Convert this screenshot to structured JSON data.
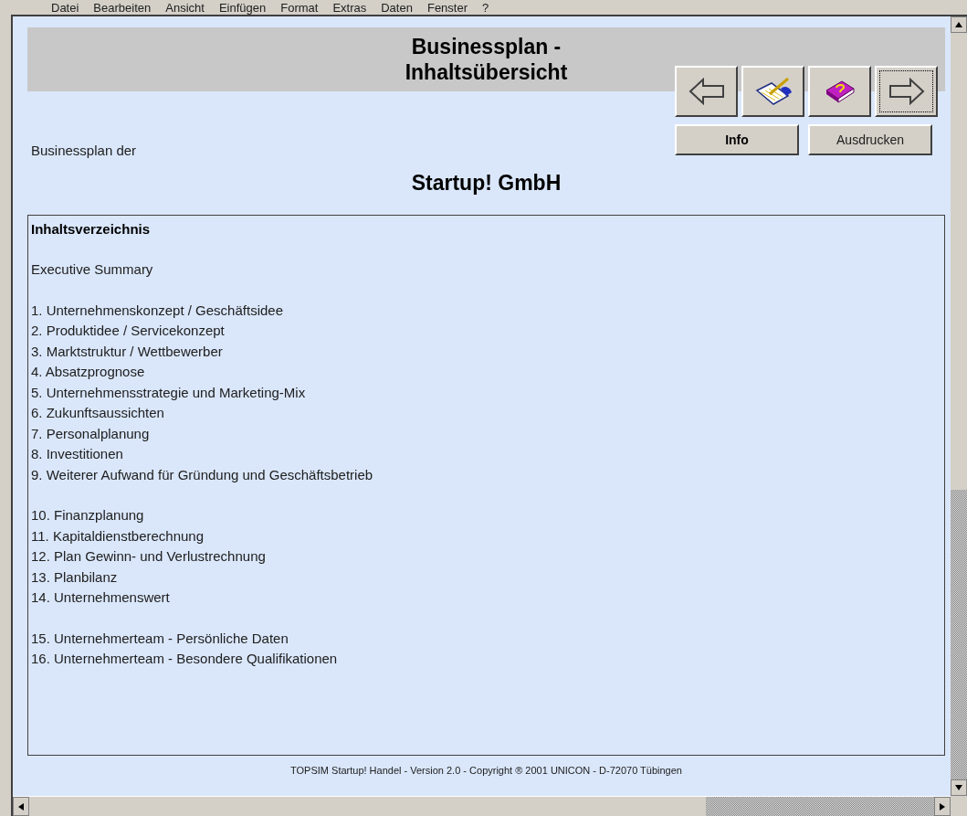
{
  "menu": [
    "Datei",
    "Bearbeiten",
    "Ansicht",
    "Einfügen",
    "Format",
    "Extras",
    "Daten",
    "Fenster",
    "?"
  ],
  "header": {
    "title_lines": [
      "Businessplan -",
      "Inhaltsübersicht"
    ]
  },
  "nav_buttons": [
    {
      "kind": "back",
      "focused": false
    },
    {
      "kind": "notes",
      "focused": false
    },
    {
      "kind": "help",
      "focused": false
    },
    {
      "kind": "forward",
      "focused": true
    }
  ],
  "buttons": [
    {
      "label": "Info",
      "default": true
    },
    {
      "label": "Ausdrucken",
      "default": false
    }
  ],
  "subtitle": "Businessplan der",
  "company": "Startup! GmbH",
  "contents": {
    "heading": "Inhaltsverzeichnis",
    "groups": [
      [
        "Executive Summary"
      ],
      [
        "1. Unternehmenskonzept / Geschäftsidee",
        "2. Produktidee / Servicekonzept",
        "3. Marktstruktur / Wettbewerber",
        "4. Absatzprognose",
        "5. Unternehmensstrategie und Marketing-Mix",
        "6. Zukunftsaussichten",
        "7. Personalplanung",
        "8. Investitionen",
        "9. Weiterer Aufwand für Gründung und Geschäftsbetrieb"
      ],
      [
        "10. Finanzplanung",
        "11. Kapitaldienstberechnung",
        "12. Plan Gewinn- und Verlustrechnung",
        "13. Planbilanz",
        "14. Unternehmenswert"
      ],
      [
        "15. Unternehmerteam - Persönliche Daten",
        "16. Unternehmerteam - Besondere Qualifikationen"
      ]
    ]
  },
  "footer": "TOPSIM Startup! Handel - Version 2.0 - Copyright ® 2001 UNICON - D-72070 Tübingen"
}
